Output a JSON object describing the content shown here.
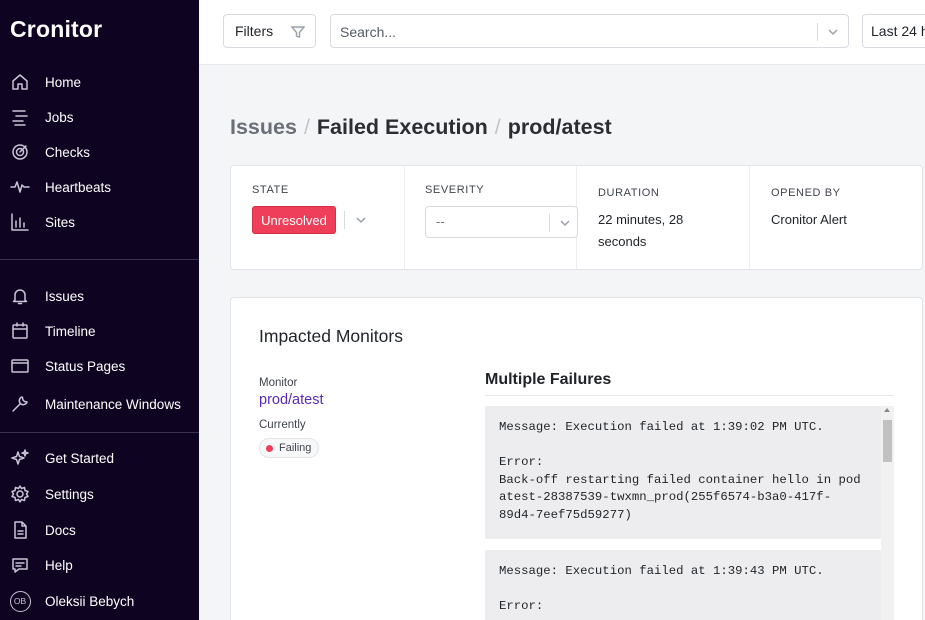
{
  "app": {
    "brand": "Cronitor"
  },
  "sidebar": {
    "primary": [
      {
        "label": "Home",
        "icon": "home-icon"
      },
      {
        "label": "Jobs",
        "icon": "jobs-icon"
      },
      {
        "label": "Checks",
        "icon": "checks-icon"
      },
      {
        "label": "Heartbeats",
        "icon": "heartbeat-icon"
      },
      {
        "label": "Sites",
        "icon": "bar-chart-icon"
      }
    ],
    "secondary": [
      {
        "label": "Issues",
        "icon": "bell-icon"
      },
      {
        "label": "Timeline",
        "icon": "calendar-icon"
      },
      {
        "label": "Status Pages",
        "icon": "window-icon"
      },
      {
        "label": "Maintenance Windows",
        "icon": "wrench-icon"
      }
    ],
    "tertiary": [
      {
        "label": "Get Started",
        "icon": "sparkle-icon"
      },
      {
        "label": "Settings",
        "icon": "gear-icon"
      },
      {
        "label": "Docs",
        "icon": "document-icon"
      },
      {
        "label": "Help",
        "icon": "chat-icon"
      }
    ],
    "user": {
      "initials": "OB",
      "name": "Oleksii Bebych"
    }
  },
  "topbar": {
    "filters_label": "Filters",
    "search_placeholder": "Search...",
    "range_label": "Last 24 h"
  },
  "breadcrumb": {
    "section": "Issues",
    "type": "Failed Execution",
    "monitor": "prod/atest"
  },
  "summary": {
    "state": {
      "label": "STATE",
      "value": "Unresolved"
    },
    "severity": {
      "label": "SEVERITY",
      "value": "--"
    },
    "duration": {
      "label": "DURATION",
      "line1": "22 minutes, 28",
      "line2": "seconds"
    },
    "opened_by": {
      "label": "OPENED BY",
      "value": "Cronitor Alert"
    }
  },
  "impacted": {
    "title": "Impacted Monitors",
    "monitor_label": "Monitor",
    "monitor_name": "prod/atest",
    "currently_label": "Currently",
    "status": "Failing",
    "failures_title": "Multiple Failures",
    "failures": [
      "Message: Execution failed at 1:39:02 PM UTC.\n\nError:\nBack-off restarting failed container hello in pod atest-28387539-twxmn_prod(255f6574-b3a0-417f-89d4-7eef75d59277)",
      "Message: Execution failed at 1:39:43 PM UTC.\n\nError:\n"
    ]
  },
  "colors": {
    "sidebar_bg": "#0e0421",
    "accent_purple": "#5b2bb8",
    "state_red": "#ef3e5a"
  }
}
